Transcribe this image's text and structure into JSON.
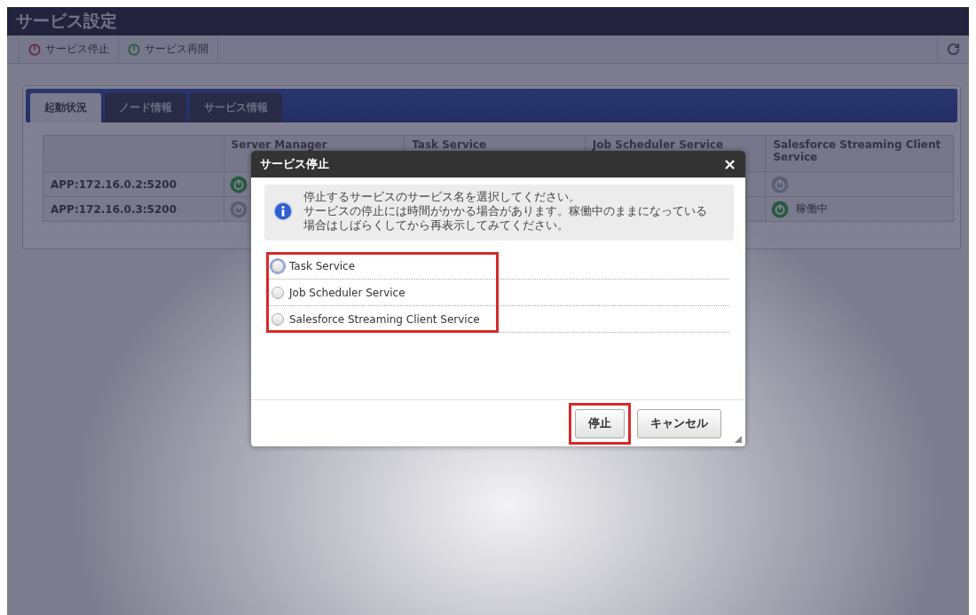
{
  "window": {
    "title": "サービス設定"
  },
  "toolbar": {
    "buttons": [
      {
        "label": "サービス停止",
        "kind": "stop"
      },
      {
        "label": "サービス再開",
        "kind": "resume"
      }
    ]
  },
  "tabs": [
    {
      "label": "起動状況",
      "selected": true
    },
    {
      "label": "ノード情報",
      "selected": false
    },
    {
      "label": "サービス情報",
      "selected": false
    }
  ],
  "table": {
    "columns": [
      "Server Manager",
      "Task Service",
      "Job Scheduler Service",
      "Salesforce Streaming Client Service"
    ],
    "rows": [
      {
        "node": "APP:172.16.0.2:5200",
        "cells": [
          {
            "running": true
          },
          null,
          null,
          {
            "running": false
          }
        ]
      },
      {
        "node": "APP:172.16.0.3:5200",
        "cells": [
          {
            "running": false
          },
          null,
          null,
          {
            "running": true,
            "status": "稼働中"
          }
        ]
      }
    ]
  },
  "dialog": {
    "title": "サービス停止",
    "close": "×",
    "message": [
      "停止するサービスのサービス名を選択してください。",
      "サービスの停止には時間がかかる場合があります。稼働中のままになっている場合はしばらくしてから再表示してみてください。"
    ],
    "options_highlighted": true,
    "options": [
      {
        "label": "Task Service",
        "selected": false,
        "focused": true
      },
      {
        "label": "Job Scheduler Service",
        "selected": false,
        "focused": false
      },
      {
        "label": "Salesforce Streaming Client Service",
        "selected": false,
        "focused": false
      }
    ],
    "buttons": [
      {
        "label": "停止",
        "highlighted": true
      },
      {
        "label": "キャンセル",
        "highlighted": false
      }
    ]
  }
}
